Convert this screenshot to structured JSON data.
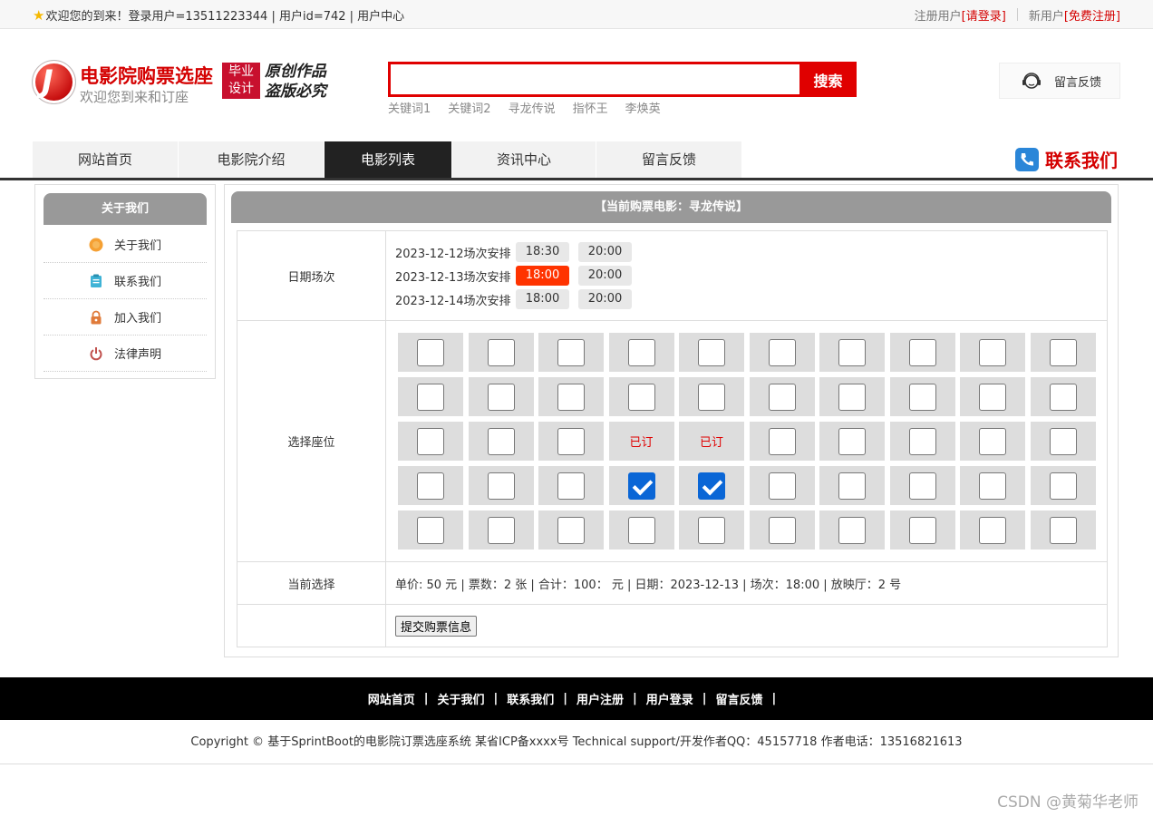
{
  "topbar": {
    "welcome": "欢迎您的到来！登录用户=13511223344 | 用户id=742 | 用户中心",
    "register_user_label": "注册用户",
    "login_link": "[请登录]",
    "new_user_label": "新用户",
    "register_link": "[免费注册]"
  },
  "header": {
    "logo_letter": "J",
    "title": "电影院购票选座",
    "subtitle": "欢迎您到来和订座",
    "badge_line1": "毕业",
    "badge_line2": "设计",
    "original_line1": "原创作品",
    "original_line2": "盗版必究",
    "search_placeholder": "",
    "search_button": "搜索",
    "keywords": [
      "关键词1",
      "关键词2",
      "寻龙传说",
      "指怀王",
      "李焕英"
    ],
    "feedback_button": "留言反馈"
  },
  "nav": {
    "items": [
      "网站首页",
      "电影院介绍",
      "电影列表",
      "资讯中心",
      "留言反馈"
    ],
    "active": "电影列表",
    "contact": "联系我们"
  },
  "sidebar": {
    "title": "关于我们",
    "items": [
      {
        "label": "关于我们",
        "icon": "circle-icon"
      },
      {
        "label": "联系我们",
        "icon": "clipboard-icon"
      },
      {
        "label": "加入我们",
        "icon": "lock-icon"
      },
      {
        "label": "法律声明",
        "icon": "power-icon"
      }
    ]
  },
  "main": {
    "title": "【当前购票电影：寻龙传说】",
    "schedule_label": "日期场次",
    "schedule": [
      {
        "date": "2023-12-12场次安排",
        "times": [
          "18:30",
          "20:00"
        ],
        "selected": ""
      },
      {
        "date": "2023-12-13场次安排",
        "times": [
          "18:00",
          "20:00"
        ],
        "selected": "18:00"
      },
      {
        "date": "2023-12-14场次安排",
        "times": [
          "18:00",
          "20:00"
        ],
        "selected": ""
      }
    ],
    "seat_label": "选择座位",
    "booked_text": "已订",
    "seat_rows": [
      [
        "empty",
        "empty",
        "empty",
        "empty",
        "empty",
        "empty",
        "empty",
        "empty",
        "empty",
        "empty"
      ],
      [
        "empty",
        "empty",
        "empty",
        "empty",
        "empty",
        "empty",
        "empty",
        "empty",
        "empty",
        "empty"
      ],
      [
        "empty",
        "empty",
        "empty",
        "booked",
        "booked",
        "empty",
        "empty",
        "empty",
        "empty",
        "empty"
      ],
      [
        "empty",
        "empty",
        "empty",
        "checked",
        "checked",
        "empty",
        "empty",
        "empty",
        "empty",
        "empty"
      ],
      [
        "empty",
        "empty",
        "empty",
        "empty",
        "empty",
        "empty",
        "empty",
        "empty",
        "empty",
        "empty"
      ]
    ],
    "current_label": "当前选择",
    "current_text": "单价: 50 元 | 票数：2 张 | 合计：100：  元 | 日期：2023-12-13 | 场次：18:00 | 放映厅：2 号",
    "submit_button": "提交购票信息"
  },
  "footer": {
    "links": [
      "网站首页",
      "关于我们",
      "联系我们",
      "用户注册",
      "用户登录",
      "留言反馈"
    ],
    "separator": "|",
    "copyright": "Copyright © 基于SprintBoot的电影院订票选座系统    某省ICP备xxxx号    Technical support/开发作者QQ：45157718    作者电话：13516821613"
  },
  "watermark": "CSDN @黄菊华老师",
  "colors": {
    "accent": "#e00000",
    "nav_active": "#222222",
    "seat_bg": "#dddddd",
    "checked": "#0a66d6",
    "slot_selected": "#ff3300"
  }
}
